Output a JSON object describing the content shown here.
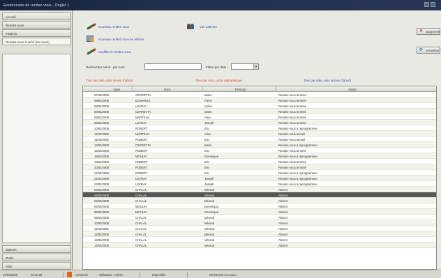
{
  "window": {
    "title": "Gestionnaire de rendez-vous - Onglet 1"
  },
  "sidebar": {
    "top_buttons": [
      {
        "label": "Accueil"
      },
      {
        "label": "Rendez-vous"
      },
      {
        "label": "Patients"
      },
      {
        "label": "Rendez-vous à venir (en cours)"
      }
    ],
    "bottom_buttons": [
      {
        "label": "Options"
      },
      {
        "label": "Outils"
      },
      {
        "label": "Aide"
      }
    ]
  },
  "actions": {
    "new_appointment": "Nouveau rendez-vous",
    "new_in_waiting": "Nouveau rendez-vous en attente",
    "modify_selected": "Modifier le rendez-vous",
    "patients": "Voir patients",
    "delete": "Supprimer",
    "refresh": "Actualiser"
  },
  "filter": {
    "search_label": "Rechercher selon : par nom",
    "search_value": "",
    "date_label": "Filtrer par date :",
    "date_value": ""
  },
  "sort_links": {
    "by_date": "Trier par date, plus récent d'abord",
    "by_name": "Trier par nom, ordre alphabétique",
    "by_recent": "Trier par date, plus ancien d'abord"
  },
  "table": {
    "columns": [
      "Date",
      "Nom",
      "Prénom",
      "Statut"
    ],
    "rows": [
      [
        "07/02/2008",
        "CERRETTA",
        "Mario",
        "Rendez-vous terminé"
      ],
      [
        "08/02/2008",
        "EDWARDS",
        "Pierre",
        "Rendez-vous terminé"
      ],
      [
        "08/02/2008",
        "LEVRAY",
        "Sylvie",
        "Rendez-vous terminé"
      ],
      [
        "09/02/2008",
        "CERRETTA",
        "Mario",
        "Rendez-vous terminé"
      ],
      [
        "09/02/2008",
        "MARTEAU",
        "Alice",
        "Rendez-vous terminé"
      ],
      [
        "09/02/2008",
        "LEVRAY",
        "Joseph",
        "Rendez-vous terminé"
      ],
      [
        "10/02/2008",
        "ROBERT",
        "Eric",
        "Rendez-vous à reprogrammer"
      ],
      [
        "11/02/2008",
        "MARTEAU",
        "Alice",
        "Rendez-vous annulé"
      ],
      [
        "11/02/2008",
        "ROBERT",
        "Eric",
        "Rendez-vous annulé"
      ],
      [
        "13/02/2008",
        "CERRETTA",
        "Mario",
        "Rendez-vous à reprogrammer"
      ],
      [
        "14/02/2008",
        "ROBERT",
        "Eric",
        "Rendez-vous terminé"
      ],
      [
        "18/02/2008",
        "MOULIN",
        "Dominique",
        "Rendez-vous à reprogrammer"
      ],
      [
        "19/02/2008",
        "ROBERT",
        "Eric",
        "Rendez-vous terminé"
      ],
      [
        "20/02/2008",
        "ROBERT",
        "Eric",
        "Rendez-vous terminé"
      ],
      [
        "21/02/2008",
        "ROBERT",
        "Eric",
        "Rendez-vous à reprogrammer"
      ],
      [
        "21/02/2008",
        "LEVRAY",
        "Joseph",
        "Rendez-vous à reprogrammer"
      ],
      [
        "22/02/2008",
        "LEVRAY",
        "Joseph",
        "Rendez-vous à reprogrammer"
      ],
      [
        "04/03/2008",
        "CHALAL",
        "Mérand",
        "Absent"
      ],
      [
        "04/03/2008",
        "CHALAL",
        "Mérand",
        "Absent"
      ],
      [
        "04/03/2008",
        "CHALAL",
        "Mérand",
        "Absent"
      ],
      [
        "04/03/2008",
        "MOULIN",
        "Dominique",
        "Absent"
      ],
      [
        "06/03/2008",
        "MOULIN",
        "Dominique",
        "Absent"
      ],
      [
        "06/03/2008",
        "CHALAL",
        "Mérand",
        "Absent"
      ],
      [
        "10/03/2008",
        "CHALAL",
        "Mérand",
        "Absent"
      ],
      [
        "11/03/2008",
        "CHALAL",
        "Mérand",
        "Absent"
      ],
      [
        "12/03/2008",
        "CHALAL",
        "Mérand",
        "Absent"
      ],
      [
        "13/03/2008",
        "CHALAL",
        "Mérand",
        "Absent"
      ],
      [
        "14/03/2008",
        "CHALAL",
        "Mérand",
        "Absent"
      ]
    ],
    "selected_row": 18
  },
  "status_bar": {
    "date": "14/03/2008",
    "time": "10:45:28",
    "mode": "Connecté",
    "user": "Utilisateur : Admin",
    "state": "Disponible",
    "info": "Recherche en cours..."
  },
  "colors": {
    "accent_link": "#2a4fbf",
    "sort_link_red": "#d6402c",
    "sort_link_blue": "#2a4fbf",
    "selection": "#565656",
    "status_indicator": "#e2641c"
  }
}
